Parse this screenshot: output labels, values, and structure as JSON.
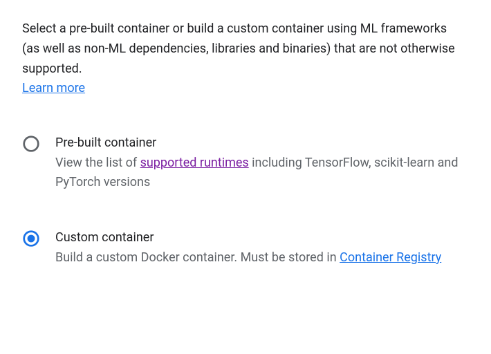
{
  "intro": {
    "text": "Select a pre-built container or build a custom container using ML frameworks (as well as non-ML dependencies, libraries and binaries) that are not otherwise supported.",
    "learn_more_label": "Learn more"
  },
  "options": {
    "prebuilt": {
      "title": "Pre-built container",
      "desc_prefix": "View the list of ",
      "desc_link": "supported runtimes",
      "desc_suffix": " including TensorFlow, scikit-learn and PyTorch versions",
      "selected": false
    },
    "custom": {
      "title": "Custom container",
      "desc_prefix": "Build a custom Docker container. Must be stored in ",
      "desc_link": "Container Registry",
      "desc_suffix": "",
      "selected": true
    }
  },
  "colors": {
    "radio_unselected": "#5f6368",
    "radio_selected": "#1a73e8"
  }
}
